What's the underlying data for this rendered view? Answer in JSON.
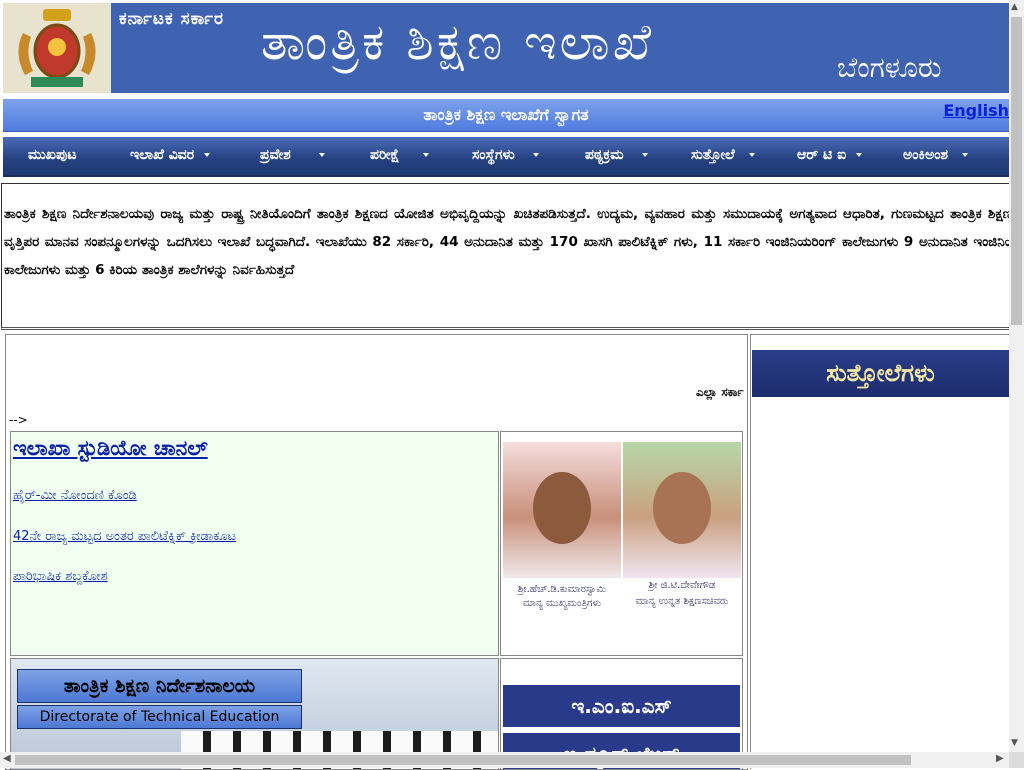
{
  "header": {
    "gov_label": "ಕರ್ನಾಟಕ ಸರ್ಕಾರ",
    "dept_title": "ತಾಂತ್ರಿಕ ಶಿಕ್ಷಣ ಇಲಾಖೆ",
    "city": "ಬೆಂಗಳೂರು",
    "emblem": "karnataka-emblem"
  },
  "welcome": {
    "text": "ತಾಂತ್ರಿಕ ಶಿಕ್ಷಣ ಇಲಾಖೆಗೆ ಸ್ವಾಗತ",
    "english_link": "English"
  },
  "nav": {
    "items": [
      {
        "label": "ಮುಖಪುಟ"
      },
      {
        "label": "ಇಲಾಖೆ ವಿವರ"
      },
      {
        "label": "ಪ್ರವೇಶ"
      },
      {
        "label": "ಪರೀಕ್ಷೆ"
      },
      {
        "label": "ಸಂಸ್ಥೆಗಳು"
      },
      {
        "label": "ಪಠ್ಯಕ್ರಮ"
      },
      {
        "label": "ಸುತ್ತೋಲೆ"
      },
      {
        "label": "ಆರ್ ಟಿ ಐ"
      },
      {
        "label": "ಅಂಕಿಅಂಶ"
      }
    ]
  },
  "intro": {
    "text": "ತಾಂತ್ರಿಕ ಶಿಕ್ಷಣ ನಿರ್ದೇಶನಾಲಯವು ರಾಜ್ಯ ಮತ್ತು ರಾಷ್ಟ್ರ ನೀತಿಯೊಂದಿಗೆ ತಾಂತ್ರಿಕ ಶಿಕ್ಷಣದ ಯೋಜಿತ ಅಭಿವೃದ್ದಿಯನ್ನು ಖಚಿತಪಡಿಸುತ್ತದೆ. ಉದ್ಯಮ, ವ್ಯವಹಾರ ಮತ್ತು ಸಮುದಾಯಕ್ಕೆ ಅಗತ್ಯವಾದ ಆಧಾರಿತ, ಗುಣಮಟ್ಟದ ತಾಂತ್ರಿಕ ಶಿಕ್ಷಣ ಮತ್ತು ವೃತ್ತಿಪರ ಮಾನವ ಸಂಪನ್ಮೂಲಗಳನ್ನು ಒದಗಿಸಲು ಇಲಾಖೆ ಬದ್ಧವಾಗಿದೆ. ಇಲಾಖೆಯು 82 ಸರ್ಕಾರಿ, 44 ಅನುದಾನಿತ ಮತ್ತು 170 ಖಾಸಗಿ ಪಾಲಿಟೆಕ್ನಿಕ್ ಗಳು, 11 ಸರ್ಕಾರಿ ಇಂಜಿನಿಯರಿಂಗ್ ಕಾಲೇಜುಗಳು 9 ಅನುದಾನಿತ ಇಂಜಿನಿಯರಿಂಗ್ ಕಾಲೇಜುಗಳು ಮತ್ತು 6 ಕಿರಿಯ ತಾಂತ್ರಿಕ ಶಾಲೆಗಳನ್ನು ನಿರ್ವಹಿಸುತ್ತದೆ"
  },
  "main": {
    "marquee_text": "ಎಲ್ಲಾ ಸರ್ಕಾ",
    "arrow_text": "-->",
    "studio": {
      "title": "ಇಲಾಖಾ ಸ್ಟುಡಿಯೋ ಚಾನಲ್",
      "links": [
        "ಹೈರ್-ಮೀ ನೋಂದಣಿ ಕೊಂಡಿ",
        "42ನೇ ರಾಜ್ಯ ಮಟ್ಟದ ಅಂತರ ಪಾಲಿಟೆಕ್ನಿಕ್ ಕ್ರೀಡಾಕೂಟ",
        "ಪಾರಿಭಾಷಿಕ ಶಬ್ದಕೋಶ"
      ]
    },
    "photos": [
      {
        "name_line": "ಶ್ರೀ.ಹೆಚ್.ಡಿ.ಕುಮಾರಸ್ವಾಮಿ",
        "role_line": "ಮಾನ್ಯ ಮುಖ್ಯಮಂತ್ರಿಗಳು"
      },
      {
        "name_line": "ಶ್ರೀ ಜಿ.ಟಿ.ದೇವೇಗೌಡ",
        "role_line": "ಮಾನ್ಯ ಉನ್ನತ ಶಿಕ್ಷಣಸಚಿವರು"
      }
    ],
    "dte": {
      "kannada": "ತಾಂತ್ರಿಕ ಶಿಕ್ಷಣ ನಿರ್ದೇಶನಾಲಯ",
      "english": "Directorate of Technical Education"
    },
    "emis": {
      "label": "ಇ.ಎಂ.ಐ.ಎಸ್",
      "second_label": "ಇ-ನ್ಯೂಸ್ ಲೆಟರ್"
    }
  },
  "sidebar": {
    "circulars_title": "ಸುತ್ತೋಲೆಗಳು"
  },
  "colors": {
    "header_bg": "#3f63b0",
    "nav_bg": "#24407e",
    "link": "#0a1ea8",
    "studio_bg": "#f0fff0"
  }
}
